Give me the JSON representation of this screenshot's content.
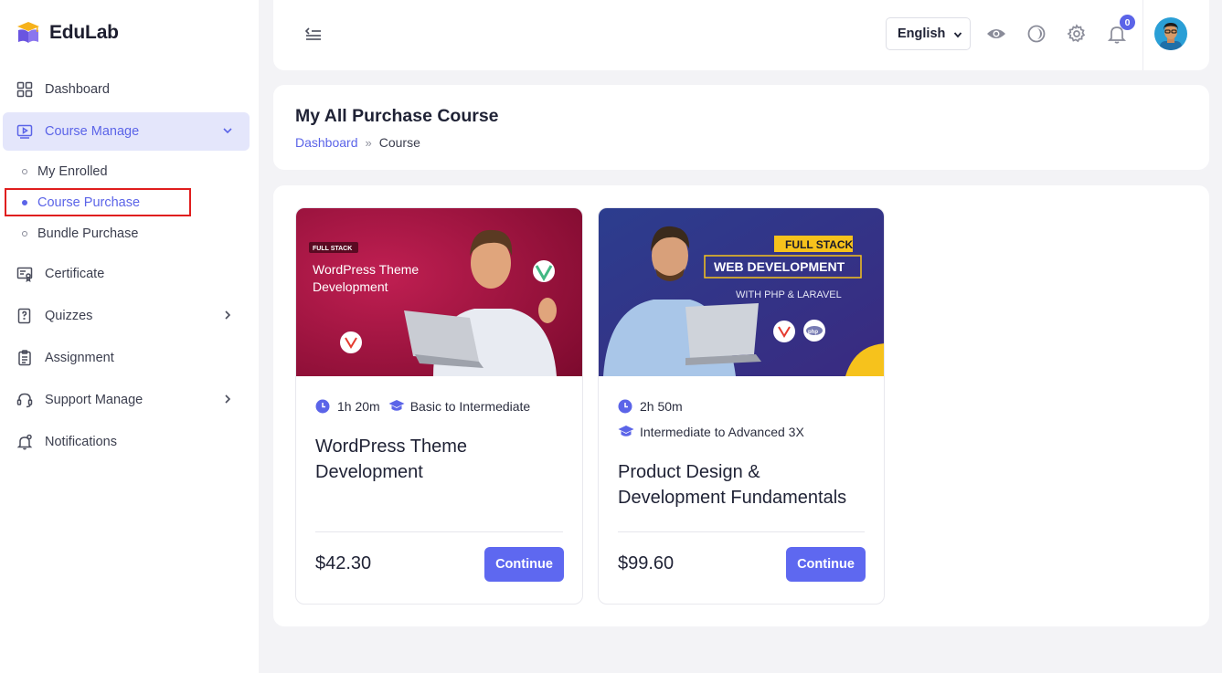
{
  "app": {
    "name": "EduLab"
  },
  "sidebar": {
    "items": [
      {
        "label": "Dashboard",
        "icon": "grid-icon"
      },
      {
        "label": "Course Manage",
        "icon": "video-icon",
        "active": true,
        "expanded": true
      },
      {
        "label": "Certificate",
        "icon": "certificate-icon"
      },
      {
        "label": "Quizzes",
        "icon": "quiz-icon"
      },
      {
        "label": "Assignment",
        "icon": "clipboard-icon"
      },
      {
        "label": "Support Manage",
        "icon": "headset-icon"
      },
      {
        "label": "Notifications",
        "icon": "bell-icon"
      }
    ],
    "sub_items": [
      {
        "label": "My Enrolled"
      },
      {
        "label": "Course Purchase",
        "active": true
      },
      {
        "label": "Bundle Purchase"
      }
    ]
  },
  "topbar": {
    "language": "English",
    "notification_count": "0",
    "icons": [
      "sidebar-collapse-icon",
      "eye-icon",
      "theme-icon",
      "gear-icon",
      "bell-icon"
    ]
  },
  "page": {
    "title": "My All Purchase Course",
    "breadcrumb": {
      "home": "Dashboard",
      "separator": "»",
      "current": "Course"
    }
  },
  "courses": [
    {
      "duration": "1h 20m",
      "level": "Basic to Intermediate",
      "title": "WordPress Theme Development",
      "price": "$42.30",
      "button": "Continue",
      "thumb": {
        "tag": "FULL STACK",
        "line1": "WordPress Theme",
        "line2": "Development"
      }
    },
    {
      "duration": "2h 50m",
      "level": "Intermediate to Advanced 3X",
      "title": "Product Design & Development Fundamentals",
      "price": "$99.60",
      "button": "Continue",
      "thumb": {
        "tag": "FULL STACK",
        "line1": "WEB DEVELOPMENT",
        "line2": "WITH PHP & LARAVEL",
        "logo1": "php"
      }
    }
  ],
  "colors": {
    "accent": "#5b64e8",
    "highlight": "#e01e1e",
    "thumb1_bg": "#a8123f",
    "thumb2_bg": "#2b2c7a",
    "tag_yellow": "#f6c21c"
  }
}
